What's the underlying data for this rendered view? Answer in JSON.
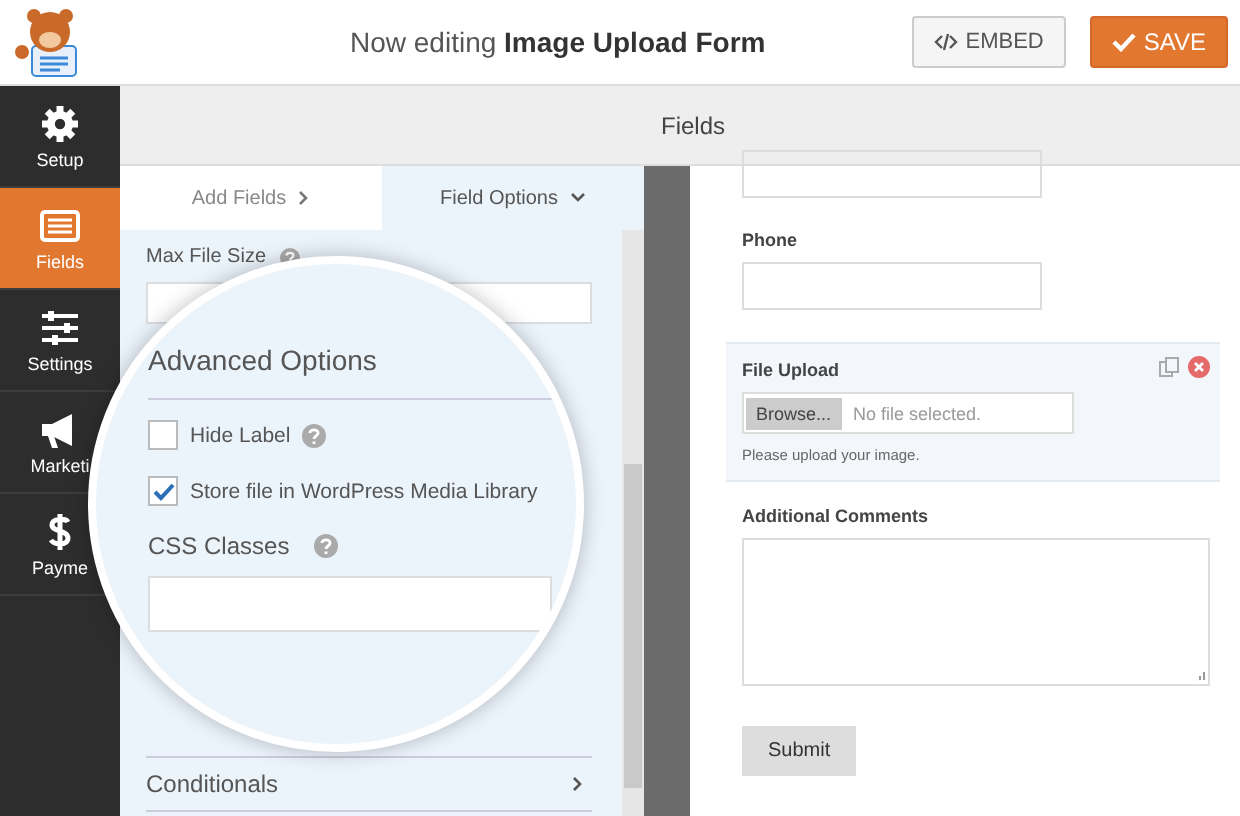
{
  "header": {
    "editing_prefix": "Now editing",
    "form_name": "Image Upload Form",
    "embed_button": "EMBED",
    "save_button": "SAVE"
  },
  "section_title": "Fields",
  "sidebar": {
    "items": [
      {
        "label": "Setup",
        "selected": false
      },
      {
        "label": "Fields",
        "selected": true
      },
      {
        "label": "Settings",
        "selected": false
      },
      {
        "label": "Marketi",
        "selected": false
      },
      {
        "label": "Payme",
        "selected": false
      }
    ]
  },
  "tabs": [
    {
      "label": "Add Fields",
      "kind": "next",
      "selected": false
    },
    {
      "label": "Field Options",
      "kind": "dropdown",
      "selected": true
    }
  ],
  "options": {
    "max_file_size": "Max File Size",
    "conditionals": "Conditionals"
  },
  "magnifier": {
    "title": "Advanced Options",
    "checkboxes": [
      {
        "label": "Hide Label",
        "checked": false,
        "help": true
      },
      {
        "label": "Store file in WordPress Media Library",
        "checked": true
      }
    ],
    "css_classes": "CSS Classes"
  },
  "preview": {
    "fields": [
      {
        "kind": "text"
      },
      {
        "kind": "text",
        "label": "Phone"
      },
      {
        "kind": "file",
        "label": "File Upload",
        "button": "Browse...",
        "status": "No file selected.",
        "description": "Please upload your image.",
        "selected": true
      },
      {
        "kind": "textarea",
        "label": "Additional Comments"
      }
    ],
    "submit": "Submit"
  }
}
